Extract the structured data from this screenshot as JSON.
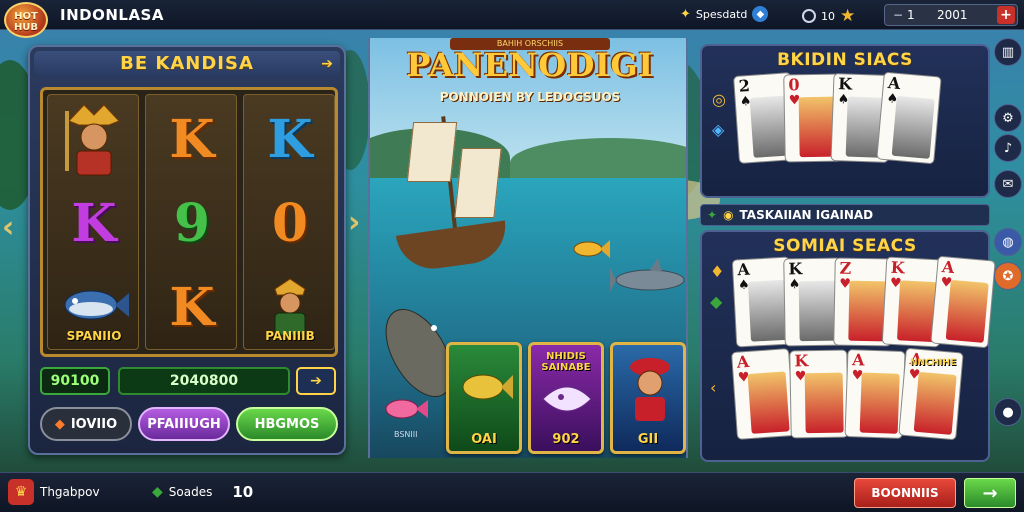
{
  "header": {
    "logo_text": "HOT HUB",
    "brand": "INDONLASA",
    "sound_label": "Spesdatd",
    "count_value": "10",
    "balance_prefix": "1",
    "balance_value": "2001",
    "minus_symbol": "−",
    "plus_symbol": "+"
  },
  "slot": {
    "title": "BE KANDISA",
    "reels": [
      [
        {
          "glyph": "",
          "label": ""
        },
        {
          "glyph": "K",
          "label": ""
        },
        {
          "glyph": "",
          "label": "SPANIIO"
        }
      ],
      [
        {
          "glyph": "K",
          "label": ""
        },
        {
          "glyph": "9",
          "label": ""
        },
        {
          "glyph": "K",
          "label": ""
        }
      ],
      [
        {
          "glyph": "K",
          "label": ""
        },
        {
          "glyph": "0",
          "label": ""
        },
        {
          "glyph": "",
          "label": "PANIIIB"
        }
      ]
    ],
    "credit_left": "90100",
    "credit_right": "2040800",
    "bet_button": "IOVIIO",
    "feature_button": "PFAIIIUGH",
    "bonus_button": "HBGMOS"
  },
  "fishing": {
    "banner": "BAHIH ORSCHIIS",
    "title": "PANENODIGI",
    "subtitle": "PONNOIEN BY LEDOGSUOS",
    "small_caption": "BSNIII",
    "cards": [
      {
        "top": "",
        "label": "OAI"
      },
      {
        "top": "NHIDIS SAINABE",
        "label": "902"
      },
      {
        "top": "",
        "label": "GII"
      }
    ]
  },
  "cards_top": {
    "title": "BKIDIN SIACS",
    "cards": [
      {
        "rank": "2",
        "suit": "♠",
        "color": "black"
      },
      {
        "rank": "0",
        "suit": "♥",
        "color": "red"
      },
      {
        "rank": "K",
        "suit": "♠",
        "color": "black"
      },
      {
        "rank": "A",
        "suit": "♠",
        "color": "black"
      }
    ]
  },
  "marquee": {
    "text": "TASKAIIAN IGAINAD"
  },
  "cards_bottom": {
    "title": "SOMIAI SEACS",
    "row1": [
      {
        "rank": "A",
        "suit": "♠",
        "color": "black"
      },
      {
        "rank": "K",
        "suit": "♠",
        "color": "black"
      },
      {
        "rank": "Z",
        "suit": "♥",
        "color": "red"
      },
      {
        "rank": "K",
        "suit": "♥",
        "color": "red"
      },
      {
        "rank": "A",
        "suit": "♥",
        "color": "red"
      }
    ],
    "row2": [
      {
        "rank": "A",
        "suit": "♥",
        "color": "red"
      },
      {
        "rank": "K",
        "suit": "♥",
        "color": "red"
      },
      {
        "rank": "A",
        "suit": "♥",
        "color": "red"
      },
      {
        "rank": "A",
        "suit": "♥",
        "color": "red"
      }
    ],
    "badge": "NNCHIHE"
  },
  "footer": {
    "left_label": "Thgabpov",
    "mid_label": "Soades",
    "mid_value": "10",
    "promo_button": "BOONNIIS",
    "go_arrow": "→"
  },
  "colors": {
    "gold": "#ffd447",
    "accent_red": "#c8312a",
    "accent_green": "#3aa83a",
    "panel_blue": "#22315a"
  }
}
